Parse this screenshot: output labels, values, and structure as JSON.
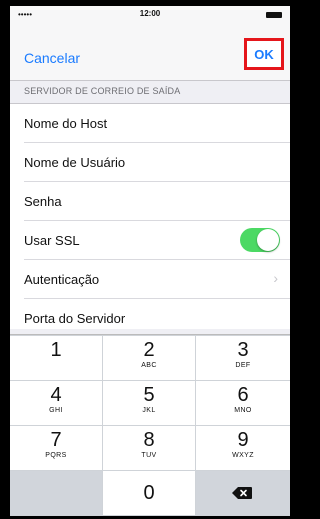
{
  "status_bar": {
    "signal": "•••••",
    "time": "12:00",
    "icons": [
      "signal-icon",
      "battery-icon"
    ]
  },
  "nav": {
    "cancel_label": "Cancelar",
    "ok_label": "OK",
    "highlight_color": "#e5161b"
  },
  "section_header": "SERVIDOR DE CORREIO DE SAÍDA",
  "rows": [
    {
      "label": "Nome do Host"
    },
    {
      "label": "Nome de Usuário"
    },
    {
      "label": "Senha"
    },
    {
      "label": "Usar SSL",
      "toggle": "on"
    },
    {
      "label": "Autenticação",
      "chevron": "›"
    },
    {
      "label": "Porta do Servidor"
    }
  ],
  "keypad": {
    "keys": [
      {
        "digit": "1",
        "letters": ""
      },
      {
        "digit": "2",
        "letters": "ABC"
      },
      {
        "digit": "3",
        "letters": "DEF"
      },
      {
        "digit": "4",
        "letters": "GHI"
      },
      {
        "digit": "5",
        "letters": "JKL"
      },
      {
        "digit": "6",
        "letters": "MNO"
      },
      {
        "digit": "7",
        "letters": "PQRS"
      },
      {
        "digit": "8",
        "letters": "TUV"
      },
      {
        "digit": "9",
        "letters": "WXYZ"
      },
      {
        "digit": "0",
        "letters": ""
      }
    ]
  },
  "colors": {
    "accent": "#1a7bff",
    "toggle_on": "#4cd964"
  }
}
